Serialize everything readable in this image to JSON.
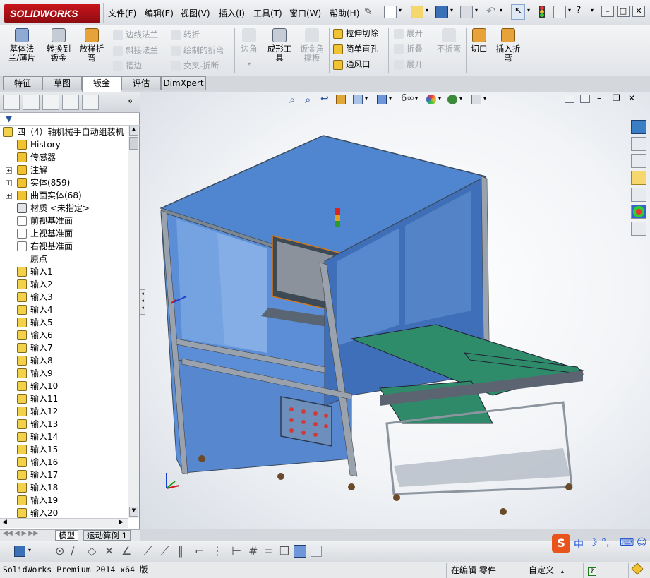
{
  "app": {
    "logo_text": "SOLIDWORKS"
  },
  "menu": [
    {
      "label": "文件(F)"
    },
    {
      "label": "编辑(E)"
    },
    {
      "label": "视图(V)"
    },
    {
      "label": "插入(I)"
    },
    {
      "label": "工具(T)"
    },
    {
      "label": "窗口(W)"
    },
    {
      "label": "帮助(H)"
    }
  ],
  "ribbon": {
    "base_flange": "基体法\n兰/薄片",
    "convert": "转换到\n钣金",
    "lofted_bend": "放样折\n弯",
    "edge_flange": "边线法兰",
    "miter_flange": "斜接法兰",
    "hem": "褶边",
    "jog": "转折",
    "sketched_bend": "绘制的折弯",
    "cross_break": "交叉-折断",
    "corners": "边角",
    "forming_tool": "成形工\n具",
    "gusset": "钣金角\n撑板",
    "extruded_cut": "拉伸切除",
    "simple_hole": "简单直孔",
    "vent": "通风口",
    "unfold": "展开",
    "fold": "折叠",
    "flatten": "展开",
    "no_bends": "不折弯",
    "rip": "切口",
    "insert_bends": "插入折\n弯"
  },
  "tabs": [
    {
      "label": "特征"
    },
    {
      "label": "草图"
    },
    {
      "label": "钣金"
    },
    {
      "label": "评估"
    },
    {
      "label": "DimXpert"
    }
  ],
  "tree": {
    "root": "四（4）轴机械手自动组装机",
    "items": [
      {
        "label": "History"
      },
      {
        "label": "传感器"
      },
      {
        "label": "注解"
      },
      {
        "label": "实体(859)"
      },
      {
        "label": "曲面实体(68)"
      },
      {
        "label": "材质 <未指定>"
      },
      {
        "label": "前视基准面"
      },
      {
        "label": "上视基准面"
      },
      {
        "label": "右视基准面"
      },
      {
        "label": "原点"
      },
      {
        "label": "输入1"
      },
      {
        "label": "输入2"
      },
      {
        "label": "输入3"
      },
      {
        "label": "输入4"
      },
      {
        "label": "输入5"
      },
      {
        "label": "输入6"
      },
      {
        "label": "输入7"
      },
      {
        "label": "输入8"
      },
      {
        "label": "输入9"
      },
      {
        "label": "输入10"
      },
      {
        "label": "输入11"
      },
      {
        "label": "输入12"
      },
      {
        "label": "输入13"
      },
      {
        "label": "输入14"
      },
      {
        "label": "输入15"
      },
      {
        "label": "输入16"
      },
      {
        "label": "输入17"
      },
      {
        "label": "输入18"
      },
      {
        "label": "输入19"
      },
      {
        "label": "输入20"
      }
    ]
  },
  "bottom_tabs": [
    {
      "label": "模型"
    },
    {
      "label": "运动算例 1"
    }
  ],
  "ime": {
    "lang": "中"
  },
  "status": {
    "app_version": "SolidWorks Premium 2014 x64 版",
    "mode": "在编辑 零件",
    "units": "自定义"
  },
  "colors": {
    "panel_blue": "#4f7fc4",
    "frame_gray": "#9aa3ad",
    "conveyor_green": "#2f8a6a",
    "accent_red": "#c8151b"
  }
}
